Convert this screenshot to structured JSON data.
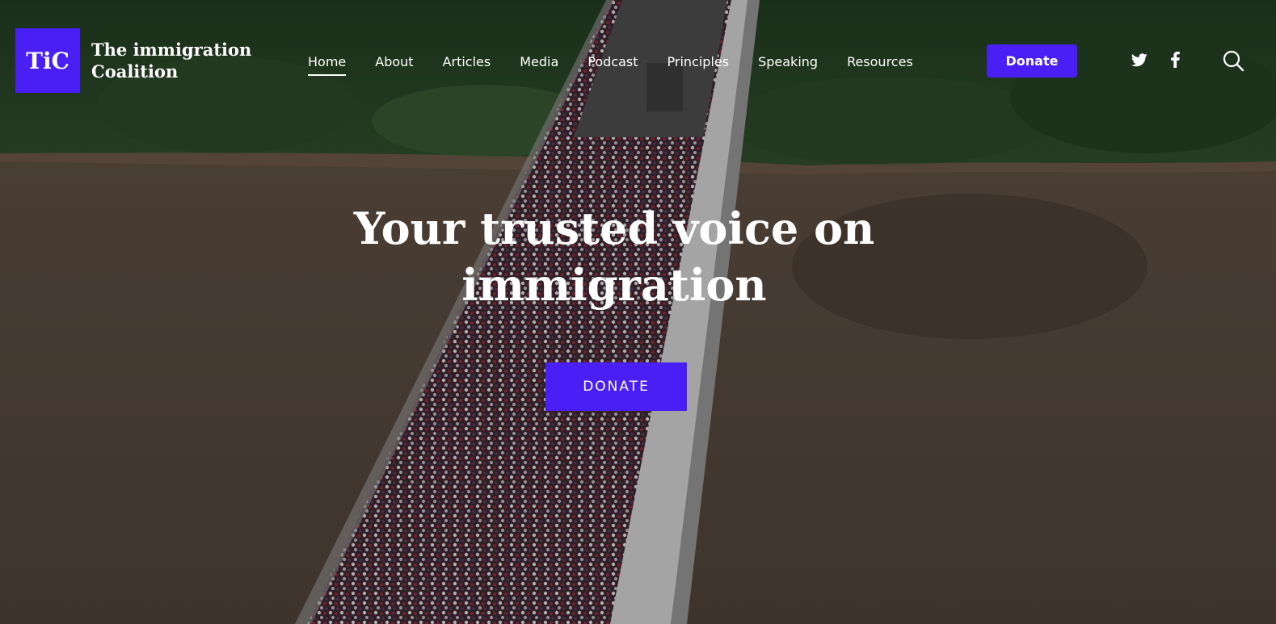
{
  "brand": {
    "mark": "TiC",
    "name_line1": "The immigration",
    "name_line2": "Coalition"
  },
  "nav": {
    "items": [
      {
        "label": "Home",
        "active": true
      },
      {
        "label": "About"
      },
      {
        "label": "Articles"
      },
      {
        "label": "Media"
      },
      {
        "label": "Podcast"
      },
      {
        "label": "Principles"
      },
      {
        "label": "Speaking"
      },
      {
        "label": "Resources"
      }
    ],
    "donate_label": "Donate"
  },
  "social": {
    "twitter_icon": "twitter-icon",
    "facebook_icon": "facebook-icon",
    "search_icon": "search-icon"
  },
  "hero": {
    "title_line1": "Your trusted voice on",
    "title_line2": "immigration",
    "cta_label": "DONATE"
  },
  "colors": {
    "accent": "#4a1ff5",
    "text": "#ffffff",
    "river": "#5a4a3c",
    "foliage": "#2e4a2a"
  }
}
